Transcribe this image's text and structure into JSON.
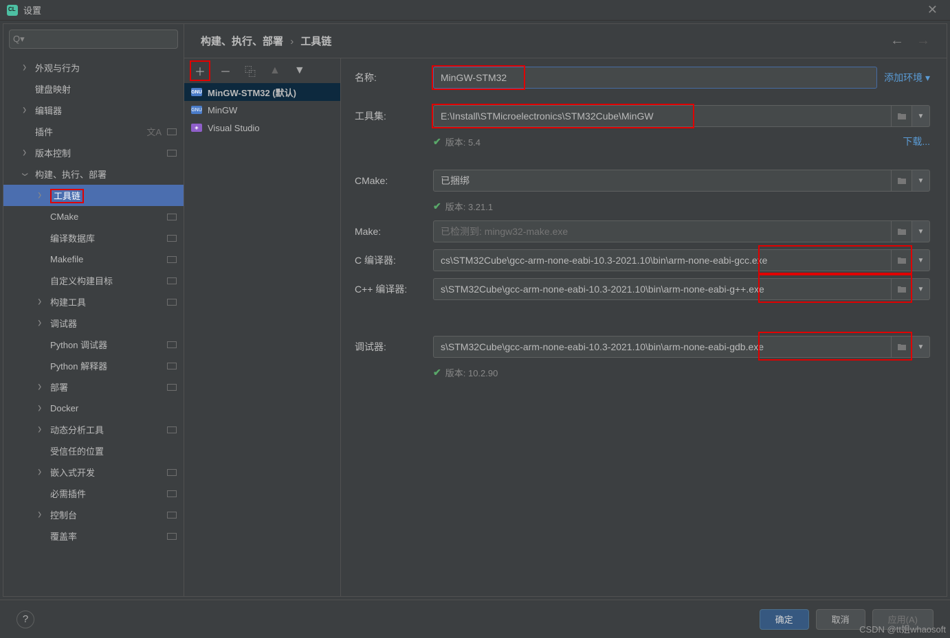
{
  "window": {
    "title": "设置"
  },
  "search": {
    "placeholder": ""
  },
  "sidebar": {
    "items": [
      {
        "label": "外观与行为",
        "chevron": true,
        "level": 0
      },
      {
        "label": "键盘映射",
        "chevron": false,
        "level": 0
      },
      {
        "label": "编辑器",
        "chevron": true,
        "level": 0
      },
      {
        "label": "插件",
        "chevron": false,
        "level": 0,
        "lang": true,
        "badge": true
      },
      {
        "label": "版本控制",
        "chevron": true,
        "level": 0,
        "badge": true
      },
      {
        "label": "构建、执行、部署",
        "chevron": true,
        "expanded": true,
        "level": 0
      },
      {
        "label": "工具链",
        "chevron": true,
        "level": 1,
        "selected": true,
        "boxed": true
      },
      {
        "label": "CMake",
        "chevron": false,
        "level": 1,
        "badge": true
      },
      {
        "label": "编译数据库",
        "chevron": false,
        "level": 1,
        "badge": true
      },
      {
        "label": "Makefile",
        "chevron": false,
        "level": 1,
        "badge": true
      },
      {
        "label": "自定义构建目标",
        "chevron": false,
        "level": 1,
        "badge": true
      },
      {
        "label": "构建工具",
        "chevron": true,
        "level": 1,
        "badge": true
      },
      {
        "label": "调试器",
        "chevron": true,
        "level": 1
      },
      {
        "label": "Python 调试器",
        "chevron": false,
        "level": 1,
        "badge": true
      },
      {
        "label": "Python 解释器",
        "chevron": false,
        "level": 1,
        "badge": true
      },
      {
        "label": "部署",
        "chevron": true,
        "level": 1,
        "badge": true
      },
      {
        "label": "Docker",
        "chevron": true,
        "level": 1
      },
      {
        "label": "动态分析工具",
        "chevron": true,
        "level": 1,
        "badge": true
      },
      {
        "label": "受信任的位置",
        "chevron": false,
        "level": 1
      },
      {
        "label": "嵌入式开发",
        "chevron": true,
        "level": 1,
        "badge": true
      },
      {
        "label": "必需插件",
        "chevron": false,
        "level": 1,
        "badge": true
      },
      {
        "label": "控制台",
        "chevron": true,
        "level": 1,
        "badge": true
      },
      {
        "label": "覆盖率",
        "chevron": false,
        "level": 1,
        "badge": true
      }
    ]
  },
  "breadcrumb": {
    "part1": "构建、执行、部署",
    "part2": "工具链"
  },
  "toolchains": {
    "items": [
      {
        "label": "MinGW-STM32 (默认)",
        "icon": "gnu",
        "selected": true,
        "bold": true
      },
      {
        "label": "MinGW",
        "icon": "gnu"
      },
      {
        "label": "Visual Studio",
        "icon": "vs"
      }
    ]
  },
  "form": {
    "name_label": "名称:",
    "name_value": "MinGW-STM32",
    "add_env_link": "添加环境",
    "toolset_label": "工具集:",
    "toolset_value": "E:\\Install\\STMicroelectronics\\STM32Cube\\MinGW",
    "toolset_version": "版本: 5.4",
    "download_link": "下载...",
    "cmake_label": "CMake:",
    "cmake_value": "已捆绑",
    "cmake_version": "版本: 3.21.1",
    "make_label": "Make:",
    "make_placeholder": "已检测到: mingw32-make.exe",
    "c_label": "C 编译器:",
    "c_value": "cs\\STM32Cube\\gcc-arm-none-eabi-10.3-2021.10\\bin\\arm-none-eabi-gcc.exe",
    "cpp_label": "C++ 编译器:",
    "cpp_value": "s\\STM32Cube\\gcc-arm-none-eabi-10.3-2021.10\\bin\\arm-none-eabi-g++.exe",
    "debugger_label": "调试器:",
    "debugger_value": "s\\STM32Cube\\gcc-arm-none-eabi-10.3-2021.10\\bin\\arm-none-eabi-gdb.exe",
    "debugger_version": "版本: 10.2.90"
  },
  "footer": {
    "ok": "确定",
    "cancel": "取消",
    "apply": "应用(A)"
  },
  "watermark": "CSDN @tt姐whaosoft"
}
